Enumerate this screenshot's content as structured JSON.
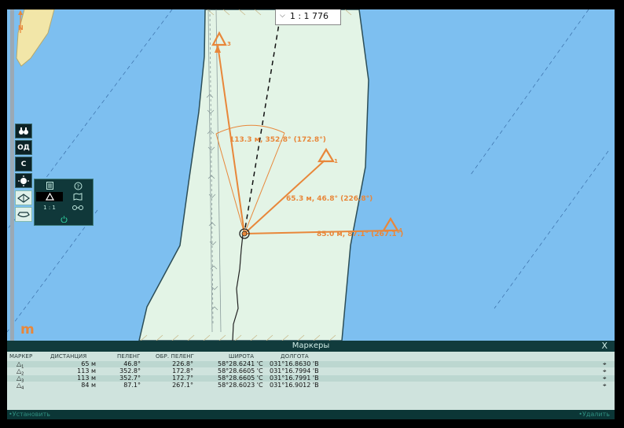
{
  "map": {
    "scale": "1 : 1 776",
    "north_label": "N",
    "measurements": [
      "113.3 м, 352.8° (172.8°)",
      "65.3 м, 46.8° (226.8°)",
      "85.0 м, 87.1° (267.1°)"
    ],
    "marker_numbers": [
      "1",
      "2",
      "3",
      "4"
    ],
    "colors": {
      "water": "#7dbff0",
      "land": "#e3f4e6",
      "marker": "#e8873a",
      "panel": "#113b3c"
    }
  },
  "toolbar": {
    "items": [
      "binoculars-icon",
      "ОД",
      "С",
      "brightness-icon",
      "map-layer-icon",
      "ship-icon"
    ],
    "od_label": "ОД",
    "c_label": "С"
  },
  "flyout": {
    "items": [
      "list-icon",
      "help-icon",
      "marker-icon",
      "map-marker-icon",
      "ruler-map-icon",
      "distance-icon",
      "power-icon"
    ],
    "ruler_label": "1 : 1"
  },
  "logo": "m",
  "markers_panel": {
    "title": "Маркеры",
    "close": "X",
    "columns": [
      "МАРКЕР",
      "ДИСТАНЦИЯ",
      "ПЕЛЕНГ",
      "ОБР. ПЕЛЕНГ",
      "ШИРОТА",
      "ДОЛГОТА"
    ],
    "rows": [
      {
        "marker": "1",
        "distance": "65 м",
        "bearing": "46.8°",
        "reverse": "226.8°",
        "lat": "58°28.6241 'С",
        "lon": "031°16.8630 'В"
      },
      {
        "marker": "2",
        "distance": "113 м",
        "bearing": "352.8°",
        "reverse": "172.8°",
        "lat": "58°28.6605 'С",
        "lon": "031°16.7994 'В"
      },
      {
        "marker": "3",
        "distance": "113 м",
        "bearing": "352.7°",
        "reverse": "172.7°",
        "lat": "58°28.6605 'С",
        "lon": "031°16.7991 'В"
      },
      {
        "marker": "4",
        "distance": "84 м",
        "bearing": "87.1°",
        "reverse": "267.1°",
        "lat": "58°28.6023 'С",
        "lon": "031°16.9012 'В"
      }
    ],
    "set_button": "•Установить",
    "delete_button": "•Удалить"
  }
}
